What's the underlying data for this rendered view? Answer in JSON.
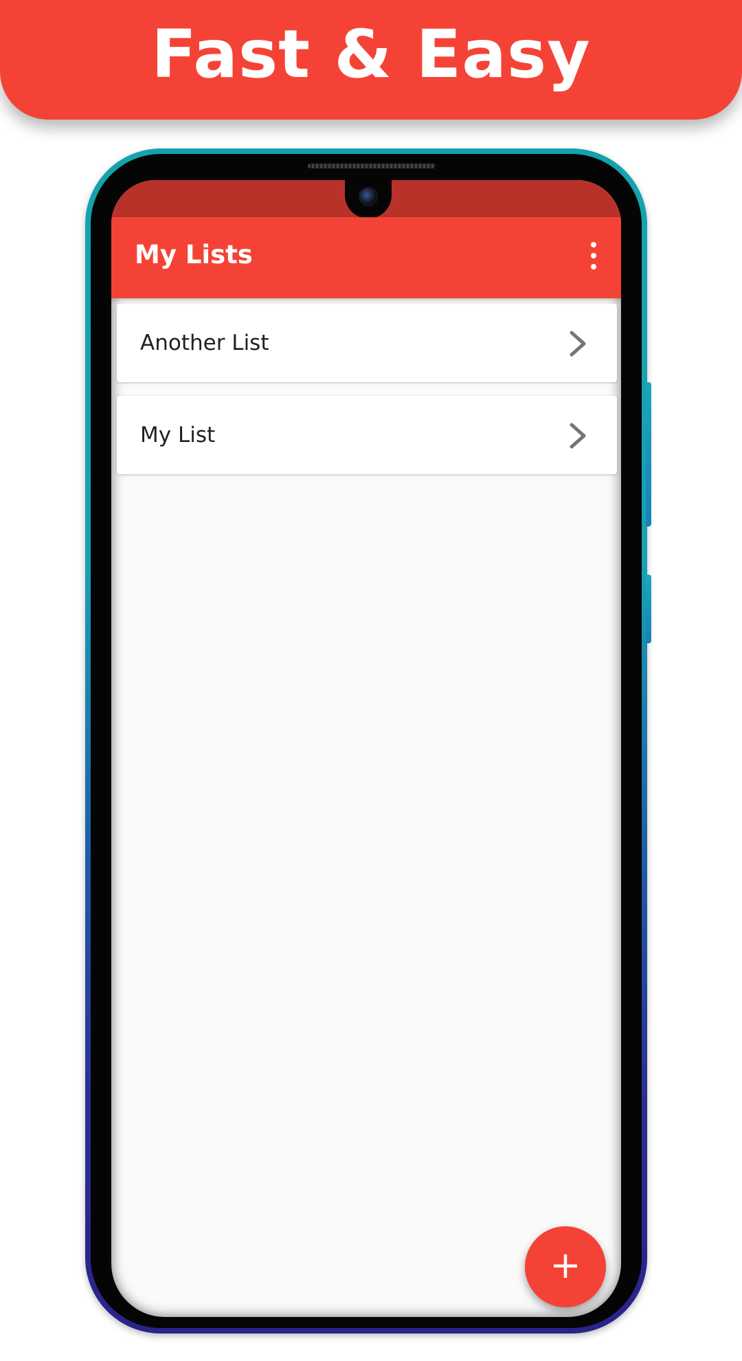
{
  "banner": {
    "title": "Fast & Easy",
    "color": "#f44336"
  },
  "app": {
    "title": "My Lists",
    "menu_icon": "more-vert-icon",
    "primary_color": "#f44336",
    "status_bar_color": "#b93229"
  },
  "lists": [
    {
      "label": "Another List",
      "icon": "chevron-right-icon"
    },
    {
      "label": "My List",
      "icon": "chevron-right-icon"
    }
  ],
  "fab": {
    "label": "+",
    "icon": "add-icon"
  }
}
